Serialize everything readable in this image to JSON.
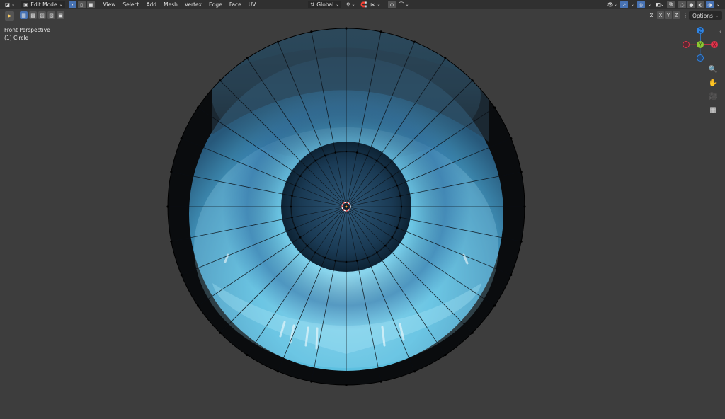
{
  "header": {
    "mode_label": "Edit Mode",
    "menus": [
      "View",
      "Select",
      "Add",
      "Mesh",
      "Vertex",
      "Edge",
      "Face",
      "UV"
    ],
    "transform_orientation": "Global"
  },
  "toolbar": {
    "axis_labels": [
      "X",
      "Y",
      "Z"
    ],
    "options_label": "Options"
  },
  "viewport": {
    "view_name": "Front Perspective",
    "object_label": "(1) Circle"
  },
  "gizmo": {
    "z_label": "Z",
    "y_label": "Y",
    "x_label": "X"
  },
  "colors": {
    "header_bg": "#303030",
    "viewport_bg": "#3d3d3d",
    "accent": "#4772b3",
    "axis_x": "#e2344c",
    "axis_y": "#8bc832",
    "axis_z": "#2f84e3"
  }
}
